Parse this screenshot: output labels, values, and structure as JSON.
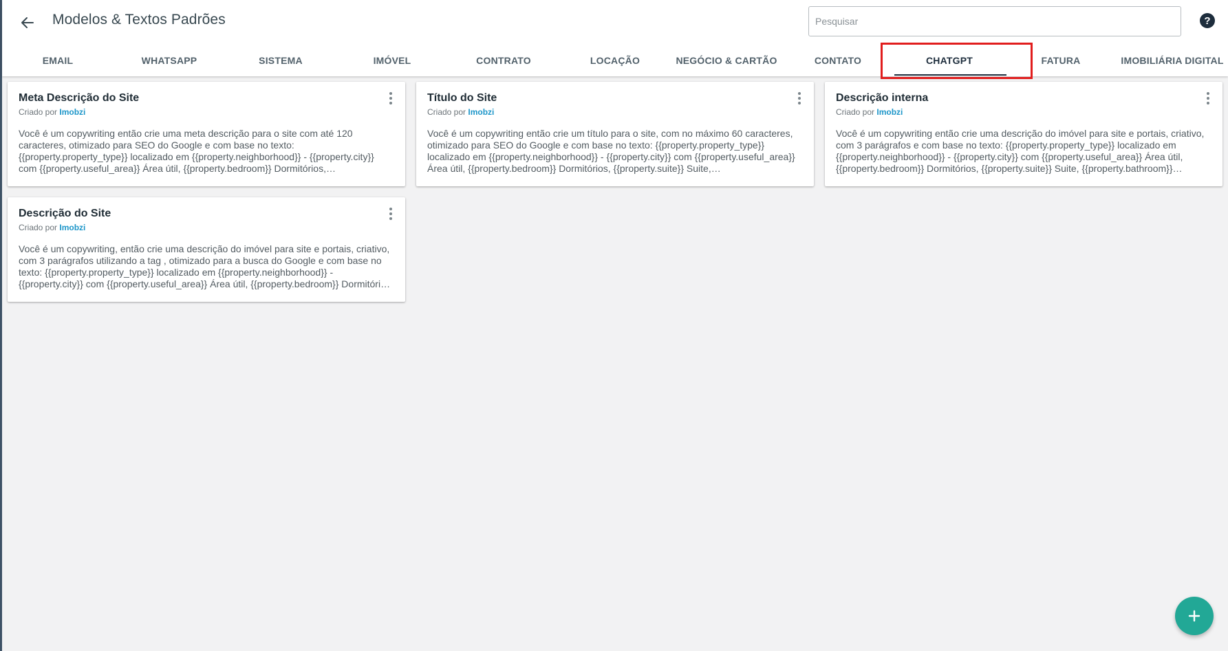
{
  "header": {
    "title": "Modelos & Textos Padrões",
    "search_placeholder": "Pesquisar",
    "help_symbol": "?"
  },
  "tabs": [
    {
      "label": "EMAIL"
    },
    {
      "label": "WHATSAPP"
    },
    {
      "label": "SISTEMA"
    },
    {
      "label": "IMÓVEL"
    },
    {
      "label": "CONTRATO"
    },
    {
      "label": "LOCAÇÃO"
    },
    {
      "label": "NEGÓCIO & CARTÃO"
    },
    {
      "label": "CONTATO"
    },
    {
      "label": "CHATGPT",
      "active": true
    },
    {
      "label": "FATURA"
    },
    {
      "label": "IMOBILIÁRIA DIGITAL"
    }
  ],
  "cards": [
    {
      "title": "Meta Descrição do Site",
      "author_prefix": "Criado por",
      "author": "Imobzi",
      "text": "Você é um copywriting então crie uma meta descrição para o site com até 120 caracteres, otimizado para SEO do Google e com base no texto: {{property.property_type}} localizado em {{property.neighborhood}} - {{property.city}} com {{property.useful_area}} Área útil, {{property.bedroom}} Dormitórios, {{property.suite}} Suite, {{property.bathroom}} Banheiro..."
    },
    {
      "title": "Título do Site",
      "author_prefix": "Criado por",
      "author": "Imobzi",
      "text": "Você é um copywriting então crie um título para o site, com no máximo 60 caracteres, otimizado para SEO do Google e com base no texto: {{property.property_type}} localizado em {{property.neighborhood}} - {{property.city}} com {{property.useful_area}} Área útil, {{property.bedroom}} Dormitórios, {{property.suite}} Suite, {{property.bathroom}} Banheiro..."
    },
    {
      "title": "Descrição interna",
      "author_prefix": "Criado por",
      "author": "Imobzi",
      "text": "Você é um copywriting então crie uma descrição do imóvel para site e portais, criativo, com 3 parágrafos e com base no texto: {{property.property_type}} localizado em {{property.neighborhood}} - {{property.city}} com {{property.useful_area}} Área útil, {{property.bedroom}} Dormitórios, {{property.suite}} Suite, {{property.bathroom}} Banheiro..."
    },
    {
      "title": "Descrição do Site",
      "author_prefix": "Criado por",
      "author": "Imobzi",
      "text": "Você é um copywriting, então crie uma descrição do imóvel para site e portais, criativo, com 3 parágrafos utilizando a tag , otimizado para a busca do Google e com base no texto: {{property.property_type}} localizado em {{property.neighborhood}} - {{property.city}} com {{property.useful_area}} Área útil, {{property.bedroom}} Dormitórios, {{property.suite}} Suit..."
    }
  ],
  "colors": {
    "accent": "#22a896",
    "link": "#1d96c9",
    "highlight": "#e11d1d"
  }
}
